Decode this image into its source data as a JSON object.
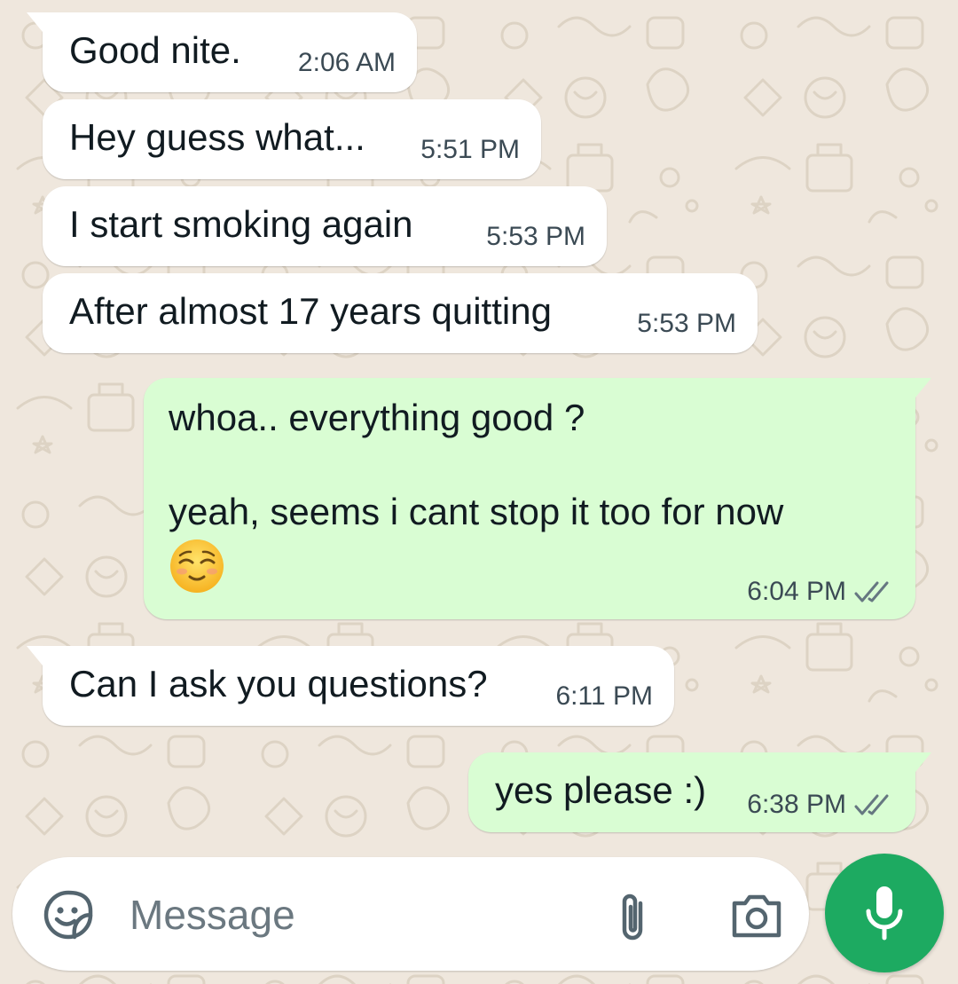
{
  "messages": [
    {
      "direction": "incoming",
      "text": "Good nite.",
      "time": "2:06 AM"
    },
    {
      "direction": "incoming",
      "text": "Hey guess what...",
      "time": "5:51 PM"
    },
    {
      "direction": "incoming",
      "text": "I start smoking again",
      "time": "5:53 PM"
    },
    {
      "direction": "incoming",
      "text": "After almost 17 years quitting",
      "time": "5:53 PM"
    },
    {
      "direction": "outgoing",
      "line1": "whoa.. everything good ?",
      "line2": "yeah, seems i cant stop it too for now",
      "emoji": "😌",
      "time": "6:04 PM",
      "status": "read",
      "status_icon": "double-check-icon"
    },
    {
      "direction": "incoming",
      "text": "Can I ask you questions?",
      "time": "6:11 PM"
    },
    {
      "direction": "outgoing",
      "text": "yes please :)",
      "time": "6:38 PM",
      "status": "read",
      "status_icon": "double-check-icon"
    }
  ],
  "composer": {
    "placeholder": "Message",
    "icons": [
      "sticker-emoji-icon",
      "paperclip-icon",
      "camera-icon",
      "microphone-icon"
    ]
  },
  "colors": {
    "wallpaper": "#efe7dd",
    "incoming_bubble": "#ffffff",
    "outgoing_bubble": "#d9fdd3",
    "send_button": "#1daa61"
  }
}
